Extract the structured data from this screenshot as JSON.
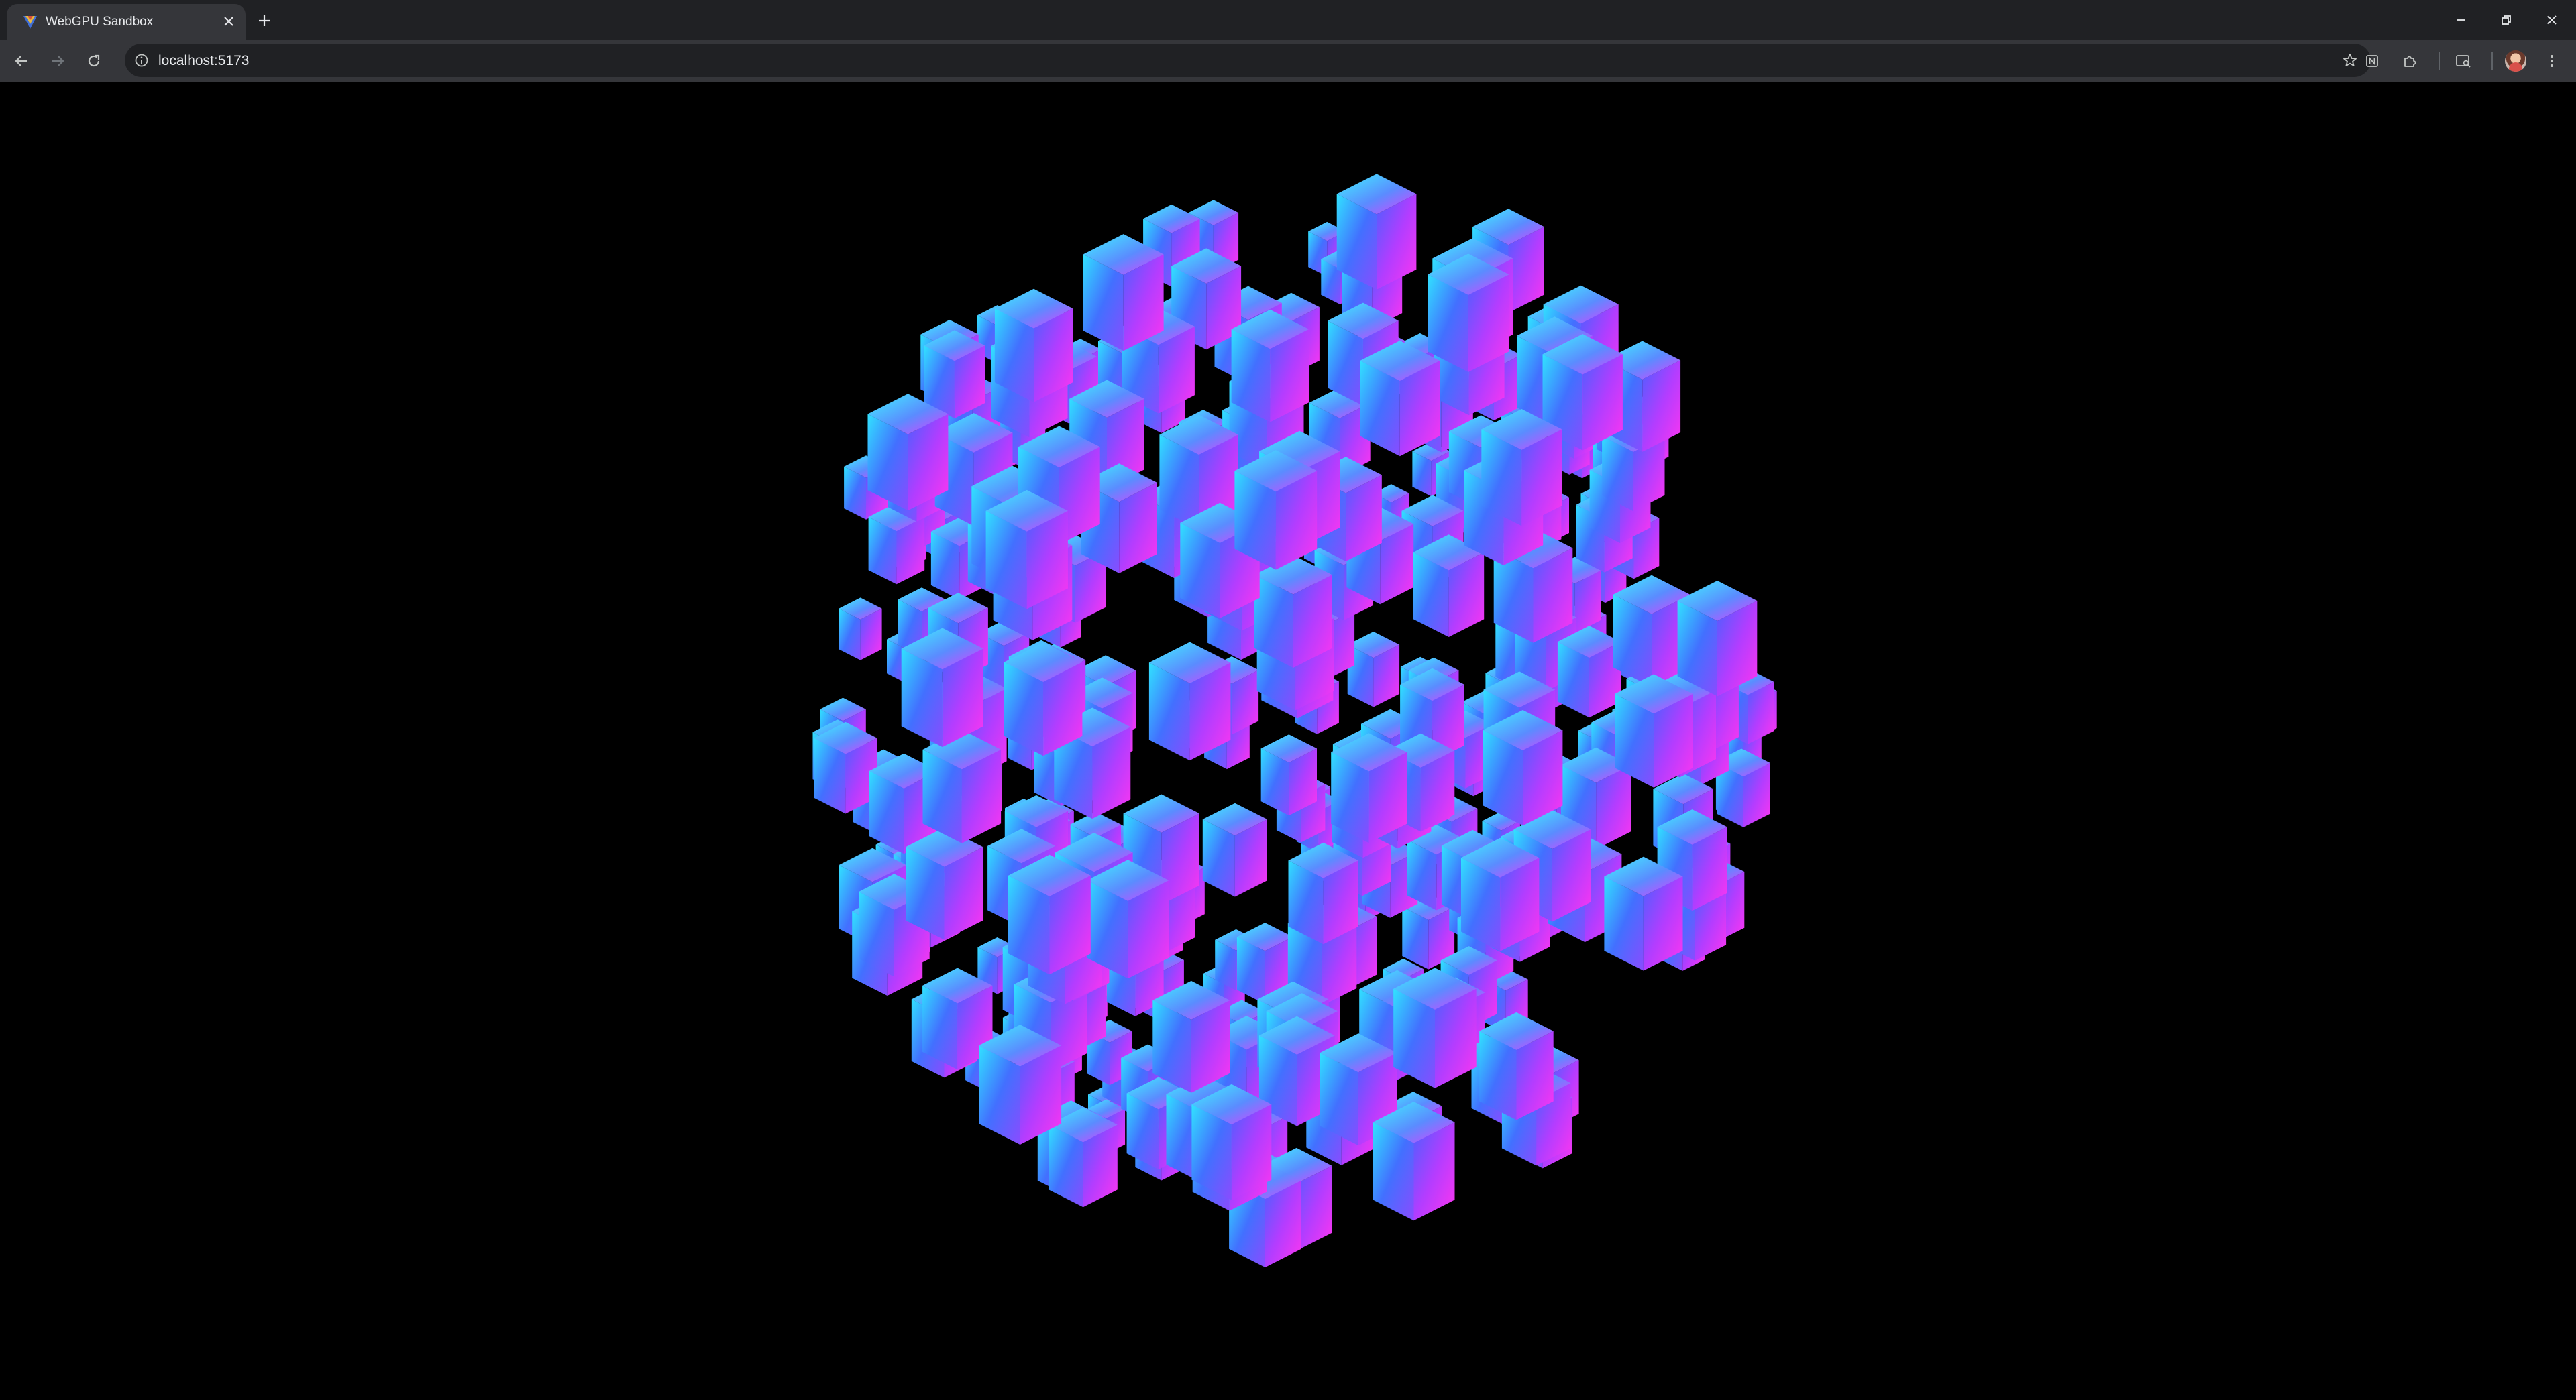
{
  "tab": {
    "title": "WebGPU Sandbox",
    "favicon": "webgpu-favicon-icon",
    "close_icon": "close-icon"
  },
  "new_tab_icon": "plus-icon",
  "window_controls": [
    "minimize-icon",
    "restore-icon",
    "close-icon"
  ],
  "toolbar": {
    "back_icon": "arrow-left-icon",
    "forward_icon": "arrow-right-icon",
    "reload_icon": "reload-icon",
    "site_info_icon": "info-icon",
    "url": "localhost:5173",
    "bookmark_icon": "star-icon",
    "extensions": [
      "notion-extension-icon",
      "puzzle-extension-icon"
    ],
    "reading_mode_icon": "search-tab-icon",
    "menu_icon": "kebab-menu-icon"
  },
  "scene": {
    "background": "#000000",
    "description_colors": {
      "cyan": "#2ef0ff",
      "blue": "#3c66ff",
      "magenta": "#ff32ff",
      "violet": "#8a4bff"
    }
  },
  "colors": {
    "tabstrip": "#202124",
    "toolbar": "#35363a",
    "omnibox": "#202124",
    "text": "#e8eaed",
    "icon": "#c4c7c5"
  }
}
